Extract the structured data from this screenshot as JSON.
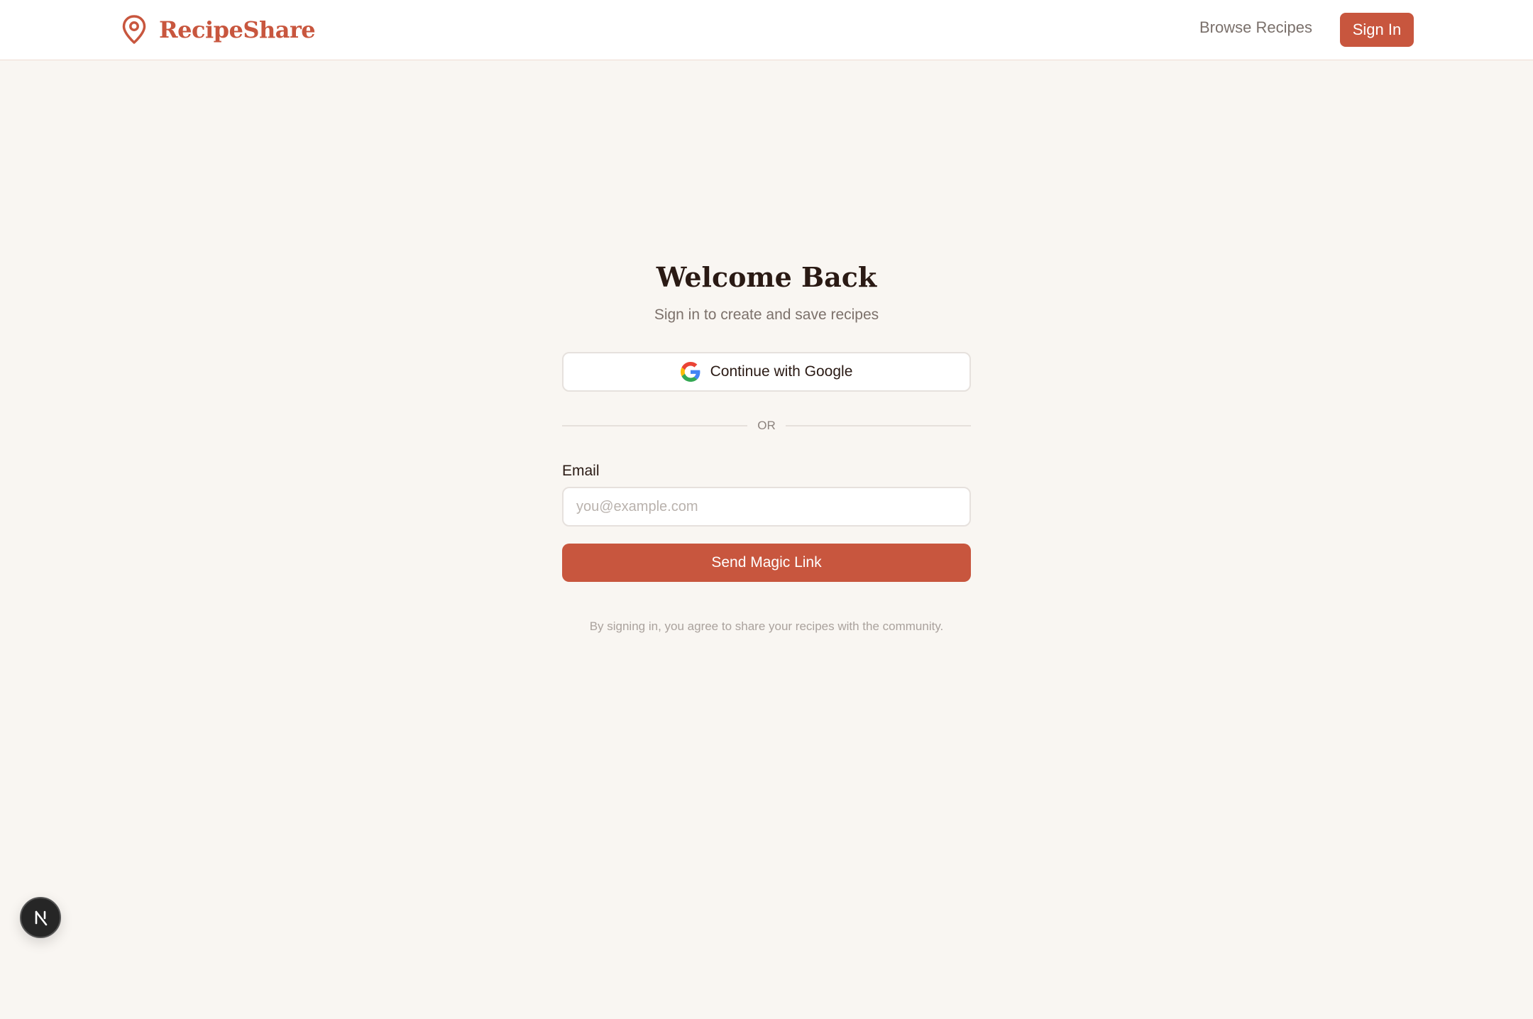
{
  "brand": {
    "name": "RecipeShare",
    "icon": "map-pin-icon",
    "color": "#c8563e"
  },
  "nav": {
    "browse_label": "Browse Recipes",
    "signin_label": "Sign In"
  },
  "login": {
    "title": "Welcome Back",
    "subtitle": "Sign in to create and save recipes",
    "google_label": "Continue with Google",
    "divider_text": "OR",
    "email_label": "Email",
    "email_placeholder": "you@example.com",
    "email_value": "",
    "submit_label": "Send Magic Link",
    "footnote": "By signing in, you agree to share your recipes with the community."
  },
  "dev_badge": {
    "icon": "nextjs-icon"
  },
  "colors": {
    "accent": "#c8563e",
    "background": "#f9f6f2",
    "text": "#2a1a14"
  }
}
